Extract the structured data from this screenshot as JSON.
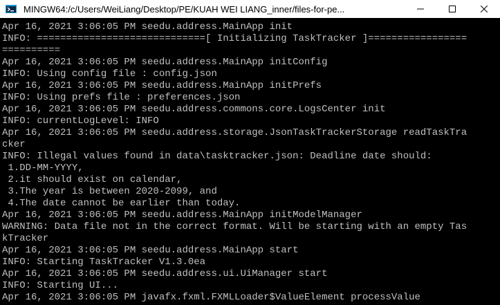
{
  "window": {
    "title": "MINGW64:/c/Users/WeiLiang/Desktop/PE/KUAH WEI LIANG_inner/files-for-pe..."
  },
  "icons": {
    "app": "mingw-terminal-icon",
    "minimize": "minimize-icon",
    "maximize": "maximize-icon",
    "close": "close-icon"
  },
  "colors": {
    "terminal_bg": "#000000",
    "terminal_fg": "#c0c0c0",
    "titlebar_bg": "#ffffff"
  },
  "console": {
    "lines": [
      "Apr 16, 2021 3:06:05 PM seedu.address.MainApp init",
      "INFO: =============================[ Initializing TaskTracker ]=================",
      "==========",
      "Apr 16, 2021 3:06:05 PM seedu.address.MainApp initConfig",
      "INFO: Using config file : config.json",
      "Apr 16, 2021 3:06:05 PM seedu.address.MainApp initPrefs",
      "INFO: Using prefs file : preferences.json",
      "Apr 16, 2021 3:06:05 PM seedu.address.commons.core.LogsCenter init",
      "INFO: currentLogLevel: INFO",
      "Apr 16, 2021 3:06:05 PM seedu.address.storage.JsonTaskTrackerStorage readTaskTra",
      "cker",
      "INFO: Illegal values found in data\\tasktracker.json: Deadline date should:",
      " 1.DD-MM-YYYY,",
      " 2.it should exist on calendar,",
      " 3.The year is between 2020-2099, and",
      " 4.The date cannot be earlier than today.",
      "Apr 16, 2021 3:06:05 PM seedu.address.MainApp initModelManager",
      "WARNING: Data file not in the correct format. Will be starting with an empty Tas",
      "kTracker",
      "Apr 16, 2021 3:06:05 PM seedu.address.MainApp start",
      "INFO: Starting TaskTracker V1.3.0ea",
      "Apr 16, 2021 3:06:05 PM seedu.address.ui.UiManager start",
      "INFO: Starting UI...",
      "Apr 16, 2021 3:06:05 PM javafx.fxml.FXMLLoader$ValueElement processValue"
    ]
  }
}
